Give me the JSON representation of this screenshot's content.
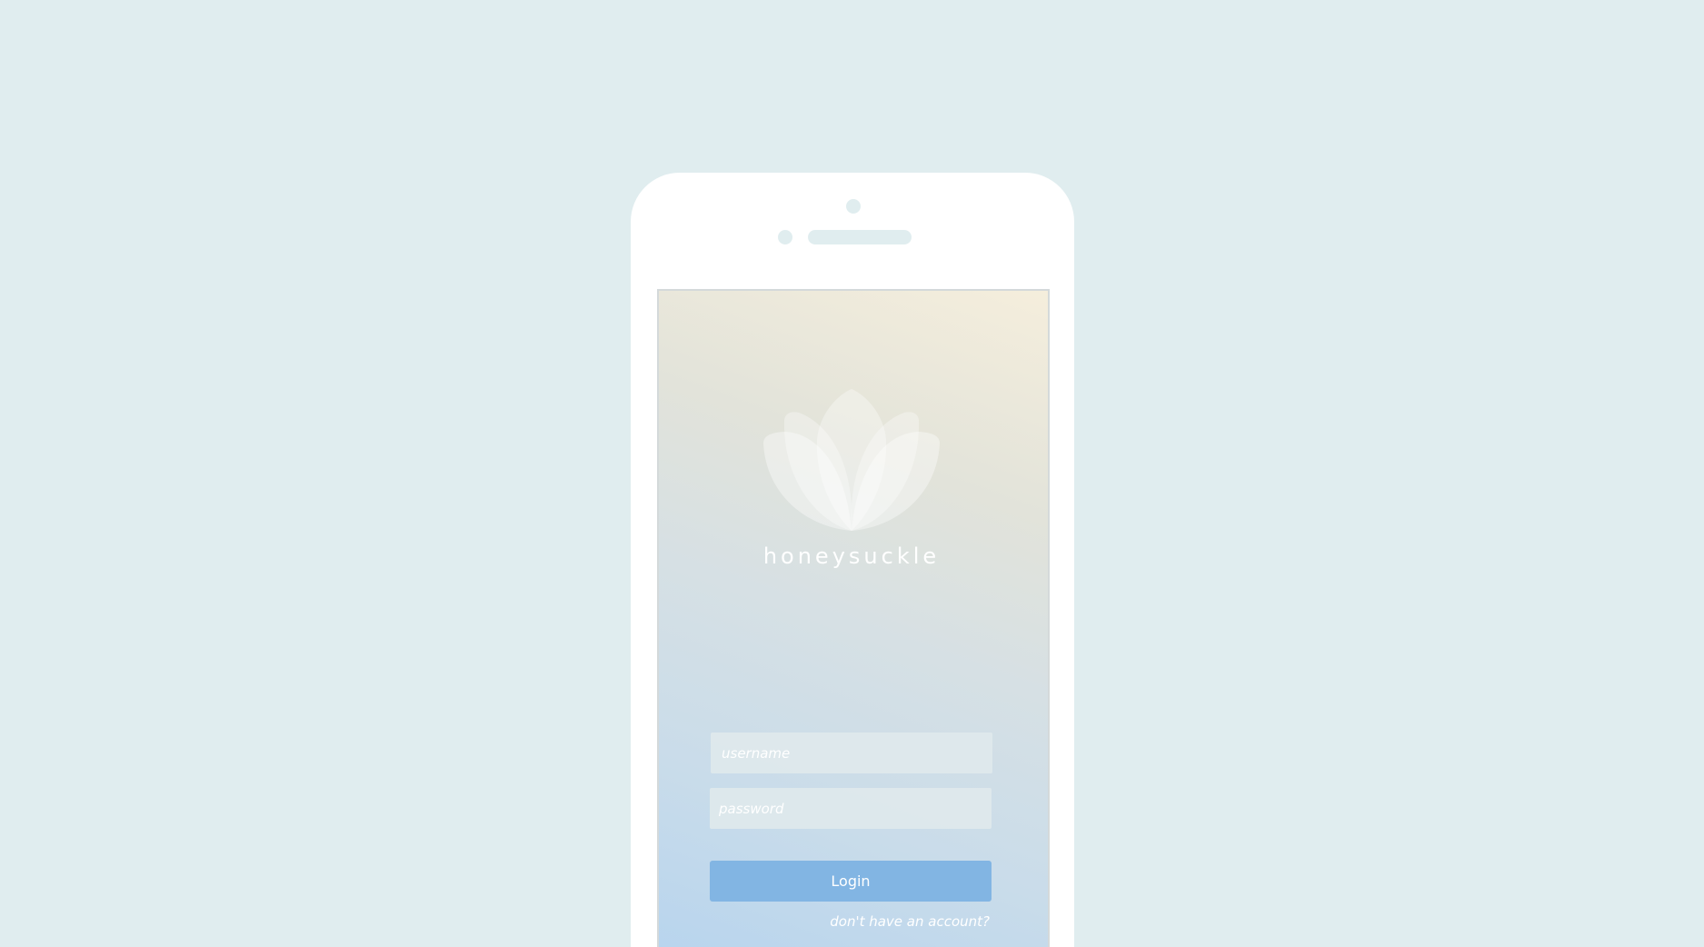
{
  "app": {
    "brand_name": "honeysuckle",
    "logo_icon": "lotus-icon"
  },
  "login_form": {
    "username_placeholder": "username",
    "password_placeholder": "password",
    "login_label": "Login",
    "signup_link_label": "don't have an account?"
  },
  "colors": {
    "page_background": "#e0edef",
    "device_body": "#ffffff",
    "login_button": "#82b5e3",
    "input_background": "#e0eaec",
    "gradient_top": "#f5eedc",
    "gradient_bottom": "#b7d4ee"
  }
}
